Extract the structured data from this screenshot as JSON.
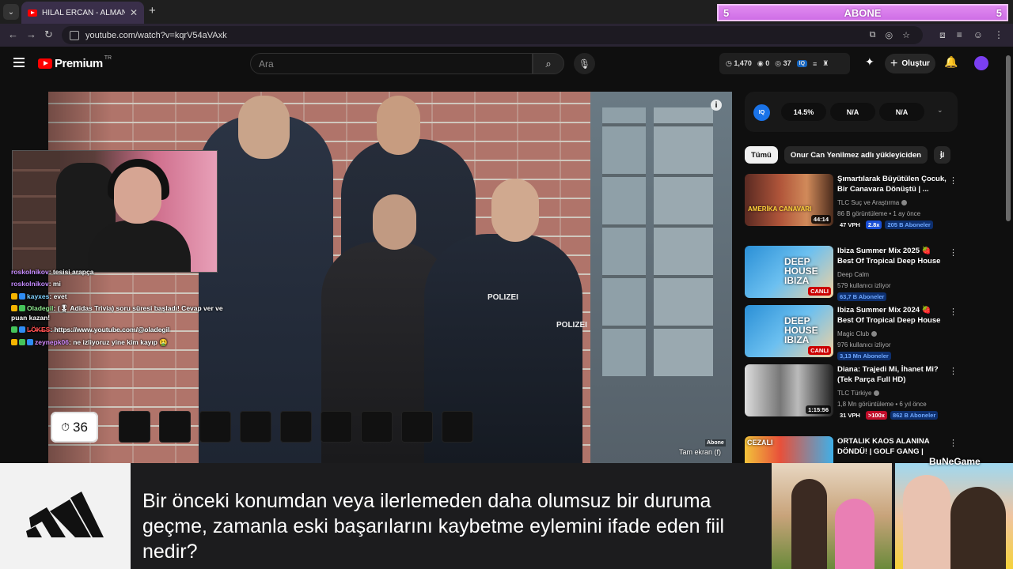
{
  "browser": {
    "tab_title": "HİLAL ERCAN - ALMANYA'DA K",
    "new_tab": "+",
    "url": "youtube.com/watch?v=kqrV54aVAxk",
    "abone_bar": {
      "left_count": "5",
      "label": "ABONE",
      "right_count": "5"
    }
  },
  "header": {
    "logo": "Premium",
    "logo_region": "TR",
    "search_placeholder": "Ara",
    "stats": {
      "views": "1,470",
      "likes": "0",
      "watch": "37"
    },
    "create_label": "Oluştur"
  },
  "video": {
    "polizei_1": "POLIZEI",
    "polizei_2": "POLIZEI",
    "abone_small": "Abone",
    "fullscreen_tip": "Tam ekran (f)"
  },
  "chat": [
    {
      "user": "roskolnikov",
      "text": "tesisi arapça"
    },
    {
      "user": "roskolnikov",
      "text": "mi"
    },
    {
      "user": "kayxes",
      "text": "evet"
    },
    {
      "user": "Oladegil",
      "text": "(🎖 Adidas Trivia) soru süresi başladı! Cevap ver ve puan kazan!"
    },
    {
      "user": "L̶Ö̶K̶E̶S̶",
      "text": "https://www.youtube.com/@oladegil"
    },
    {
      "user": "zeynepk06",
      "text": "ne izliyoruz yine kim kayıp 🤮"
    }
  ],
  "game": {
    "timer": "36",
    "slot_count": 9
  },
  "sidebar": {
    "iq_badge": "IQ",
    "iq_values": [
      "14.5%",
      "N/A",
      "N/A"
    ],
    "chips": [
      "Tümü",
      "Onur Can Yenilmez adlı yükleyiciden",
      "İl"
    ],
    "recommendations": [
      {
        "title": "Şımartılarak Büyütülen Çocuk, Bir Canavara Dönüştü | ...",
        "channel": "TLC Suç ve Araştırma",
        "stats": "86 B görüntüleme • 1 ay önce",
        "duration": "44:14",
        "thumb_text": "AMERİKA CANAVARI",
        "vph": "47 VPH",
        "ratio": "2.8x",
        "subs": "205 B Aboneler"
      },
      {
        "title": "Ibiza Summer Mix 2025 🍓 Best Of Tropical Deep House ...",
        "channel": "Deep Calm",
        "stats": "579 kullanıcı izliyor",
        "duration": "CANLI",
        "thumb_text": "DEEP HOUSE IBIZA",
        "subs": "63,7 B Aboneler"
      },
      {
        "title": "Ibiza Summer Mix 2024 🍓 Best Of Tropical Deep House ...",
        "channel": "Magic Club",
        "stats": "976 kullanıcı izliyor",
        "duration": "CANLI",
        "thumb_text": "DEEP HOUSE IBIZA",
        "subs": "3,13 Mn Aboneler"
      },
      {
        "title": "Diana: Trajedi Mi, İhanet Mi? (Tek Parça Full HD)",
        "channel": "TLC Türkiye",
        "stats": "1,8 Mn görüntüleme • 6 yıl önce",
        "duration": "1:15:56",
        "vph": "31 VPH",
        "ratio": ">100x",
        "subs": "862 B Aboneler"
      },
      {
        "title": "ORTALIK KAOS ALANINA DÖNDÜ! | GOLF GANG | CEZALI",
        "channel": "",
        "stats": "",
        "duration": "",
        "thumb_text": "CEZALI"
      }
    ]
  },
  "quiz": {
    "question": "Bir önceki konumdan veya ilerlemeden daha olumsuz bir duruma geçme, zamanla eski başarılarını kaybetme eylemini ifade eden fiil nedir?",
    "brand_watermark": "BuNeGame"
  }
}
